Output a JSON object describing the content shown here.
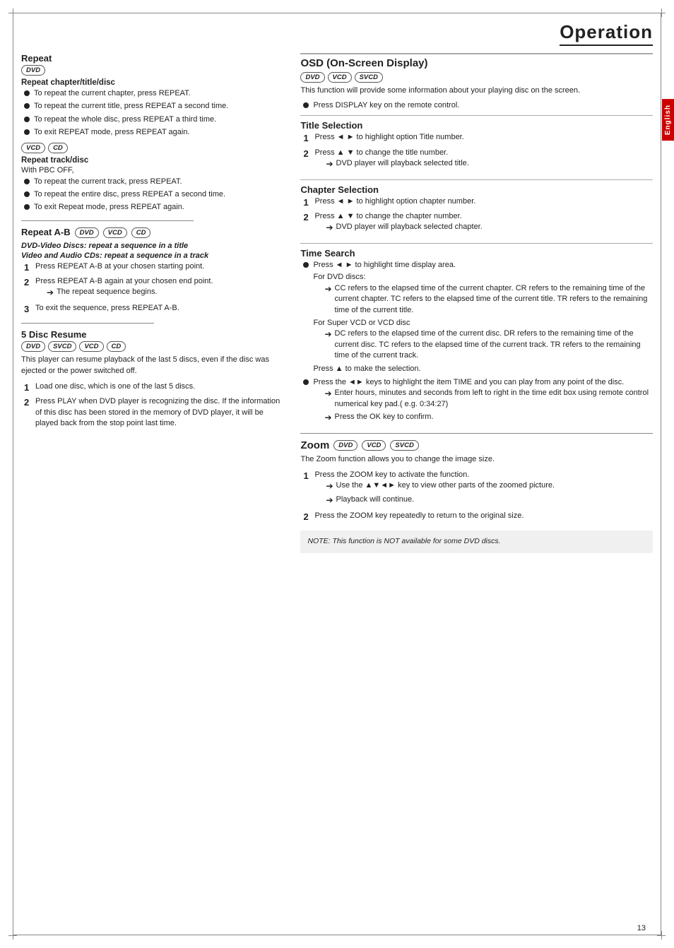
{
  "page": {
    "title": "Operation",
    "page_number": "13",
    "english_tab": "English"
  },
  "left": {
    "repeat_section": {
      "title": "Repeat",
      "badge_dvd": "DVD",
      "sub_title1": "Repeat chapter/title/disc",
      "bullets1": [
        "To repeat the current chapter, press REPEAT.",
        "To repeat the current title, press REPEAT a second time.",
        "To repeat the whole disc, press REPEAT a third time.",
        "To exit REPEAT mode, press REPEAT again."
      ],
      "badge_vcd": "VCD",
      "badge_cd": "CD",
      "sub_title2": "Repeat track/disc",
      "sub_desc": "With PBC OFF,",
      "bullets2": [
        "To repeat the current track, press REPEAT.",
        "To repeat the entire disc, press REPEAT a second time.",
        "To exit Repeat mode, press REPEAT again."
      ]
    },
    "repeat_ab": {
      "title": "Repeat A-B",
      "badge_dvd": "DVD",
      "badge_vcd": "VCD",
      "badge_cd": "CD",
      "sub_italic1": "DVD-Video Discs: repeat a sequence in a title",
      "sub_italic2": "Video and Audio CDs: repeat a sequence in a track",
      "steps": [
        "Press REPEAT A-B at your chosen starting point.",
        "Press REPEAT A-B again at your chosen end point.",
        "To exit the sequence, press REPEAT A-B."
      ],
      "arrow1": "The repeat sequence begins."
    },
    "disc_resume": {
      "title": "5 Disc Resume",
      "badge_dvd": "DVD",
      "badge_svcd": "SVCD",
      "badge_vcd": "VCD",
      "badge_cd": "CD",
      "desc": "This player can resume playback of the last 5 discs, even if the disc was ejected or the power switched off.",
      "steps": [
        "Load one disc, which is one of the last 5 discs.",
        "Press PLAY when DVD player is recognizing the disc. If the information of this disc has been stored in the memory of DVD player,  it will be played back from the stop point last time."
      ]
    }
  },
  "right": {
    "osd": {
      "title": "OSD (On-Screen Display)",
      "badge_dvd": "DVD",
      "badge_vcd": "VCD",
      "badge_svcd": "SVCD",
      "desc": "This function will provide some information about your playing disc on the screen.",
      "bullet": "Press DISPLAY key on the remote control."
    },
    "title_selection": {
      "title": "Title Selection",
      "steps": [
        "Press ◄ ► to highlight option Title number.",
        "Press ▲ ▼ to change the title number."
      ],
      "arrow": "DVD player will playback selected title."
    },
    "chapter_selection": {
      "title": "Chapter Selection",
      "steps": [
        "Press ◄ ► to highlight option chapter number.",
        "Press ▲ ▼ to change the chapter number."
      ],
      "arrow": "DVD player will playback selected chapter."
    },
    "time_search": {
      "title": "Time Search",
      "bullet1": "Press ◄ ► to highlight time display area.",
      "for_dvd": "For DVD discs:",
      "arrow_dvd": "CC refers to the elapsed time of the current chapter. CR refers to the remaining time of the current chapter. TC refers to the elapsed time of the current title. TR refers to the remaining time of the current title.",
      "for_svcd": "For Super VCD or VCD disc",
      "arrow_svcd": "DC refers to the elapsed time of the current disc. DR refers to the remaining time of the current disc. TC refers to the elapsed time of the current track. TR refers to the remaining time of the current track.",
      "press_up": "Press ▲ to make the selection.",
      "bullet2": "Press the ◄► keys to highlight the item TIME and you can play from any point of the disc.",
      "arrow2": "Enter hours, minutes and seconds from left to right in the time edit box using remote control numerical key pad.( e.g. 0:34:27)",
      "arrow3": "Press the OK key to confirm."
    },
    "zoom": {
      "title": "Zoom",
      "badge_dvd": "DVD",
      "badge_vcd": "VCD",
      "badge_svcd": "SVCD",
      "desc": "The Zoom function allows you to change the image size.",
      "steps": [
        "Press the ZOOM key to activate the function.",
        "Press the ZOOM key repeatedly to return to the original size."
      ],
      "arrow1": "Use the ▲▼◄► key to view other parts of the zoomed picture.",
      "arrow2": "Playback will continue.",
      "note": "NOTE: This function is NOT available for some DVD discs."
    }
  }
}
